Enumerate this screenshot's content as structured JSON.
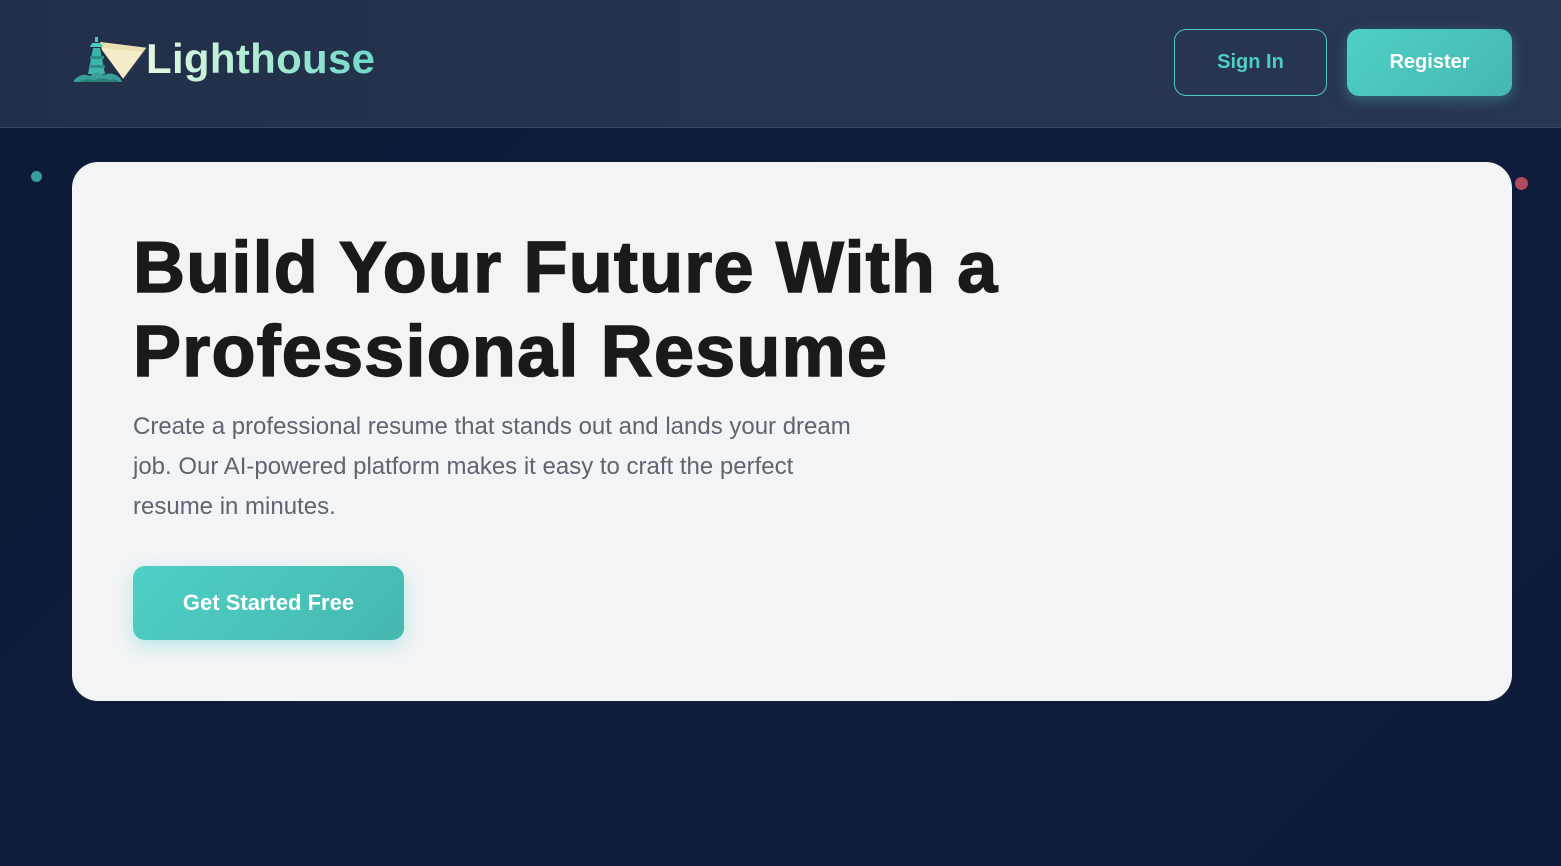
{
  "header": {
    "logo_text": "Lighthouse",
    "logo_icon": "lighthouse-icon",
    "signin_label": "Sign In",
    "register_label": "Register"
  },
  "hero": {
    "title_line1": "Build Your Future With a",
    "title_line2": "Professional Resume",
    "description": "Create a professional resume that stands out and lands your dream job. Our AI-powered platform makes it easy to craft the perfect resume in minutes.",
    "cta_label": "Get Started Free"
  },
  "colors": {
    "background": "#0d1b36",
    "header_bg": "#26344e",
    "accent": "#4ecdc4",
    "card_bg": "#f3f4f6",
    "title_text": "#1a1a1a",
    "body_text": "#5f6470",
    "decor_teal": "#3a9d98",
    "decor_red": "#b04a5d"
  }
}
